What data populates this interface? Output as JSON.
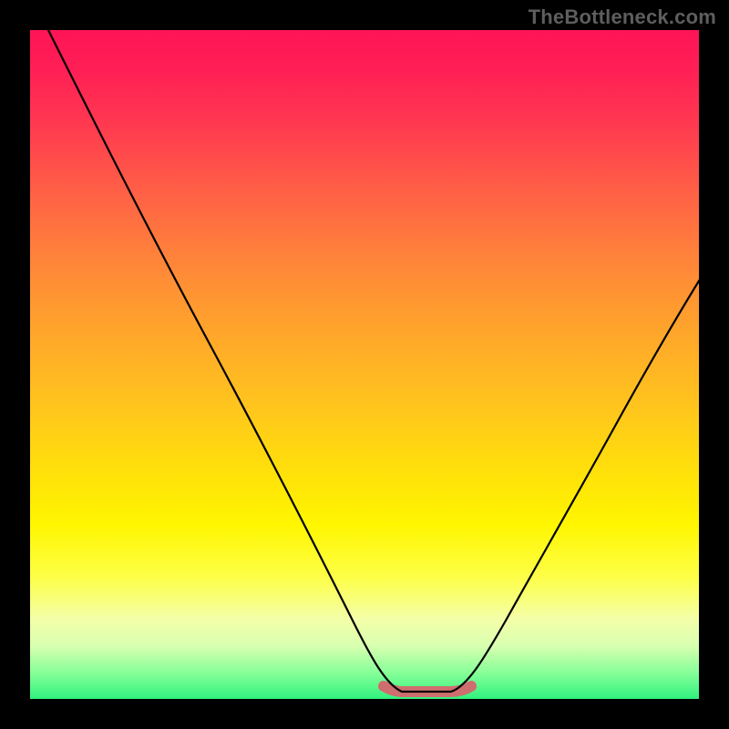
{
  "watermark": "TheBottleneck.com",
  "colors": {
    "frame": "#000000",
    "curve": "#000000",
    "highlight": "#cf6e6e",
    "watermark": "#5e5e5e"
  },
  "chart_data": {
    "type": "line",
    "title": "",
    "xlabel": "",
    "ylabel": "",
    "xlim": [
      0,
      100
    ],
    "ylim": [
      0,
      100
    ],
    "series": [
      {
        "name": "bottleneck-curve",
        "x": [
          2,
          10,
          20,
          30,
          40,
          46,
          50,
          53,
          56,
          59,
          62,
          66,
          72,
          80,
          90,
          100
        ],
        "values": [
          100,
          86,
          69,
          52,
          34,
          20,
          10,
          4,
          1,
          1,
          1,
          4,
          12,
          26,
          44,
          61
        ]
      }
    ],
    "annotations": [
      {
        "name": "optimal-range",
        "x_start": 53,
        "x_end": 66,
        "y_approx_pct": 1.2
      }
    ]
  }
}
